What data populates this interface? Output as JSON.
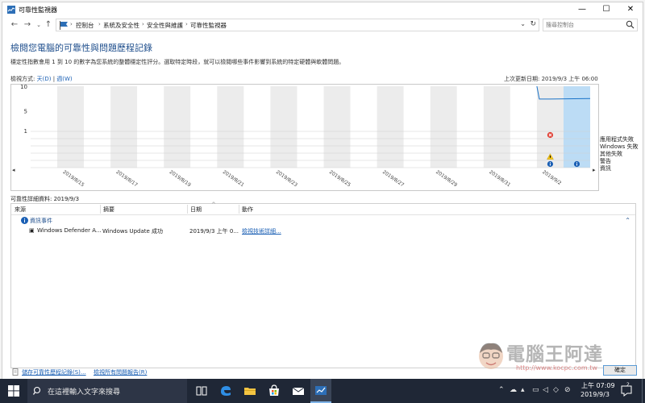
{
  "window": {
    "title": "可靠性監視器",
    "minimize": "—",
    "maximize": "☐",
    "close": "✕"
  },
  "address": {
    "crumbs": [
      "控制台",
      "系統及安全性",
      "安全性與維護",
      "可靠性監視器"
    ],
    "search_placeholder": "搜尋控制台"
  },
  "page": {
    "heading": "檢閱您電腦的可靠性與問題歷程記錄",
    "description": "穩定性指數會用 1 到 10 的數字為您系統的整體穩定性評分。選取特定時段，就可以檢閱哪些事件影響到系統的特定硬體與軟體問題。",
    "view_by_label": "檢視方式:",
    "view_days": "天(D)",
    "view_sep": "|",
    "view_weeks": "週(W)",
    "last_updated": "上次更新日期: 2019/9/3 上午 06:00"
  },
  "chart_data": {
    "type": "line",
    "y_ticks": [
      "10",
      "5",
      "1"
    ],
    "ylim": [
      1,
      10
    ],
    "x": [
      "2019/8/14",
      "2019/8/15",
      "2019/8/16",
      "2019/8/17",
      "2019/8/18",
      "2019/8/19",
      "2019/8/20",
      "2019/8/21",
      "2019/8/22",
      "2019/8/23",
      "2019/8/24",
      "2019/8/25",
      "2019/8/26",
      "2019/8/27",
      "2019/8/28",
      "2019/8/29",
      "2019/8/30",
      "2019/8/31",
      "2019/9/1",
      "2019/9/2",
      "2019/9/3"
    ],
    "x_tick_labels": [
      "2019/8/15",
      "2019/8/17",
      "2019/8/19",
      "2019/8/21",
      "2019/8/23",
      "2019/8/25",
      "2019/8/27",
      "2019/8/29",
      "2019/8/31",
      "2019/9/2"
    ],
    "stability_index": [
      {
        "date": "2019/9/2",
        "value": 7.4
      },
      {
        "date": "2019/9/3",
        "value": 7.5
      }
    ],
    "event_rows": [
      "應用程式失敗",
      "Windows 失敗",
      "其他失敗",
      "警告",
      "資訊"
    ],
    "events": [
      {
        "date": "2019/9/2",
        "row": "應用程式失敗",
        "icon": "error-icon"
      },
      {
        "date": "2019/9/2",
        "row": "警告",
        "icon": "warning-icon"
      },
      {
        "date": "2019/9/2",
        "row": "資訊",
        "icon": "info-icon"
      },
      {
        "date": "2019/9/3",
        "row": "資訊",
        "icon": "info-icon"
      }
    ],
    "selected": "2019/9/3",
    "colors": {
      "line": "#1a73c8",
      "selected": "#bcdcf5",
      "grid": "#e9e9e9",
      "error": "#e03c31",
      "warning": "#f5c518",
      "info": "#1a5fb4"
    }
  },
  "details": {
    "title": "可靠性詳細資料: 2019/9/3",
    "columns": [
      "來源",
      "摘要",
      "日期",
      "動作"
    ],
    "group": "資訊事件",
    "rows": [
      {
        "source": "Windows Defender A...",
        "summary": "Windows Update 成功",
        "date": "2019/9/3 上午 0...",
        "action": "檢視技術詳細..."
      }
    ]
  },
  "footer": {
    "save_history": "儲存可靠性歷程記錄(S)...",
    "view_all": "檢視所有問題報告(R)",
    "close_button": "確定"
  },
  "watermark": {
    "text": "電腦王阿達",
    "url": "http://www.kocpc.com.tw"
  },
  "taskbar": {
    "search_placeholder": "在這裡輸入文字來搜尋",
    "time": "上午 07:09",
    "date": "2019/9/3",
    "notification_count": "2"
  }
}
